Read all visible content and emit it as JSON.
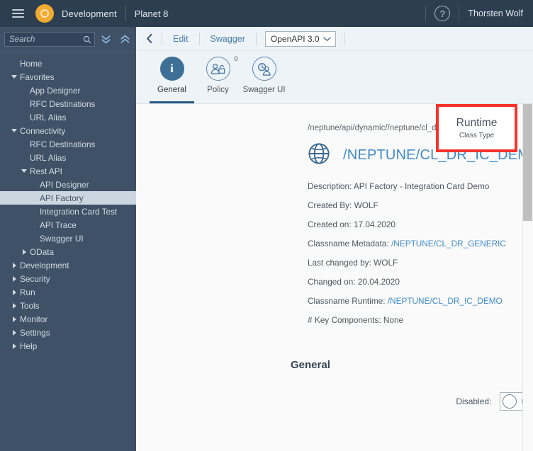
{
  "header": {
    "menu_icon": "hamburger-icon",
    "brand_icon": "planet-logo-icon",
    "title": "Development",
    "subtitle": "Planet 8",
    "help_icon": "question-mark-icon",
    "user": "Thorsten Wolf"
  },
  "sidebar": {
    "search": {
      "placeholder": "Search",
      "value": "",
      "icon": "search-icon"
    },
    "collapse_all_icon": "double-chevron-down-icon",
    "expand_all_icon": "double-chevron-up-icon",
    "items": [
      {
        "label": "Home",
        "level": 0,
        "arrow": "none",
        "selected": false
      },
      {
        "label": "Favorites",
        "level": 0,
        "arrow": "down",
        "selected": false
      },
      {
        "label": "App Designer",
        "level": 1,
        "arrow": "none",
        "selected": false
      },
      {
        "label": "RFC Destinations",
        "level": 1,
        "arrow": "none",
        "selected": false
      },
      {
        "label": "URL Alias",
        "level": 1,
        "arrow": "none",
        "selected": false
      },
      {
        "label": "Connectivity",
        "level": 0,
        "arrow": "down",
        "selected": false
      },
      {
        "label": "RFC Destinations",
        "level": 1,
        "arrow": "none",
        "selected": false
      },
      {
        "label": "URL Alias",
        "level": 1,
        "arrow": "none",
        "selected": false
      },
      {
        "label": "Rest API",
        "level": 1,
        "arrow": "down",
        "selected": false
      },
      {
        "label": "API Designer",
        "level": 2,
        "arrow": "none",
        "selected": false
      },
      {
        "label": "API Factory",
        "level": 2,
        "arrow": "none",
        "selected": true
      },
      {
        "label": "Integration Card Test",
        "level": 2,
        "arrow": "none",
        "selected": false
      },
      {
        "label": "API Trace",
        "level": 2,
        "arrow": "none",
        "selected": false
      },
      {
        "label": "Swagger UI",
        "level": 2,
        "arrow": "none",
        "selected": false
      },
      {
        "label": "OData",
        "level": 1,
        "arrow": "right",
        "selected": false
      },
      {
        "label": "Development",
        "level": 0,
        "arrow": "right",
        "selected": false
      },
      {
        "label": "Security",
        "level": 0,
        "arrow": "right",
        "selected": false
      },
      {
        "label": "Run",
        "level": 0,
        "arrow": "right",
        "selected": false
      },
      {
        "label": "Tools",
        "level": 0,
        "arrow": "right",
        "selected": false
      },
      {
        "label": "Monitor",
        "level": 0,
        "arrow": "right",
        "selected": false
      },
      {
        "label": "Settings",
        "level": 0,
        "arrow": "right",
        "selected": false
      },
      {
        "label": "Help",
        "level": 0,
        "arrow": "right",
        "selected": false
      }
    ]
  },
  "toolbar": {
    "back_icon": "chevron-left-icon",
    "edit_label": "Edit",
    "swagger_label": "Swagger",
    "version_select": {
      "value": "OpenAPI 3.0",
      "icon": "chevron-down-icon"
    }
  },
  "tabs": [
    {
      "label": "General",
      "icon": "info-icon",
      "active": true,
      "badge": ""
    },
    {
      "label": "Policy",
      "icon": "user-lock-icon",
      "active": false,
      "badge": "0"
    },
    {
      "label": "Swagger UI",
      "icon": "user-clock-icon",
      "active": false,
      "badge": ""
    }
  ],
  "detail": {
    "api_path": "/neptune/api/dynamic//neptune/cl_dr_ic_demo",
    "title_icon": "globe-icon",
    "title": "/NEPTUNE/CL_DR_IC_DEMO",
    "description": "Description: API Factory - Integration Card Demo",
    "created_by": "Created By: WOLF",
    "created_on": "Created on: 17.04.2020",
    "classname_metadata_label": "Classname Metadata: ",
    "classname_metadata_value": "/NEPTUNE/CL_DR_GENERIC",
    "last_changed_by": "Last changed by: WOLF",
    "changed_on": "Changed on: 20.04.2020",
    "classname_runtime_label": "Classname Runtime: ",
    "classname_runtime_value": "/NEPTUNE/CL_DR_IC_DEMO",
    "key_components": "# Key Components: None"
  },
  "runtime_box": {
    "title": "Runtime",
    "subtitle": "Class Type",
    "border_color": "#f8322b"
  },
  "general_section": {
    "heading": "General",
    "disabled_label": "Disabled:",
    "disabled_toggle_value": "NO"
  },
  "colors": {
    "header_bg": "#2c3e50",
    "sidebar_bg": "#3f5167",
    "accent_orange": "#f0ab30",
    "link_blue": "#3f8bc9",
    "tab_active": "#3e6f96"
  }
}
